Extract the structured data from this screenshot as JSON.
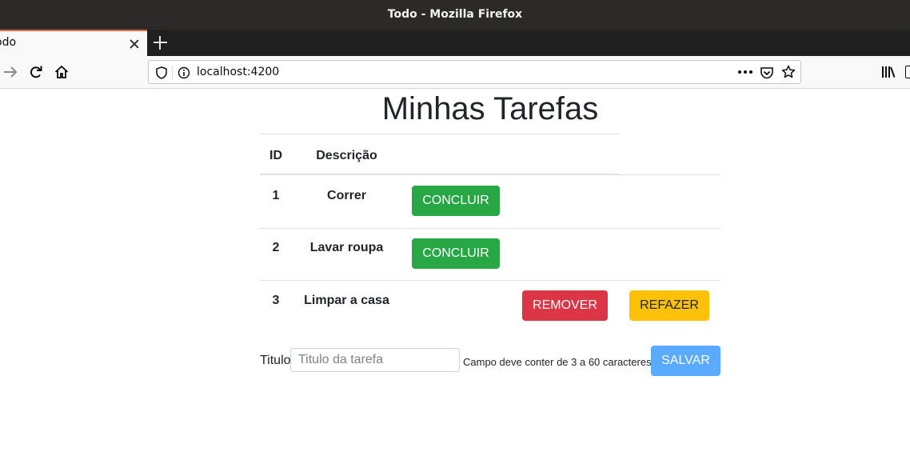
{
  "window": {
    "title": "Todo - Mozilla Firefox"
  },
  "tab": {
    "title": "odo"
  },
  "urlbar": {
    "url": "localhost:4200"
  },
  "icons": {
    "back": "arrow-right-icon",
    "reload": "reload-icon",
    "home": "home-icon",
    "shield": "shield-icon",
    "info": "info-icon",
    "more": "more-dots-icon",
    "pocket": "pocket-icon",
    "bookmark": "star-icon",
    "library": "library-icon"
  },
  "page": {
    "title": "Minhas Tarefas",
    "table": {
      "headers": [
        "ID",
        "Descrição"
      ],
      "rows": [
        {
          "id": "1",
          "description": "Correr",
          "action": "CONCLUIR"
        },
        {
          "id": "2",
          "description": "Lavar roupa",
          "action": "CONCLUIR"
        },
        {
          "id": "3",
          "description": "Limpar a casa",
          "remove": "REMOVER",
          "redo": "REFAZER"
        }
      ]
    },
    "form": {
      "label": "Titulo",
      "placeholder": "Titulo da tarefa",
      "value": "",
      "help": "Campo deve conter de 3 a 60 caracteres",
      "submit": "SALVAR"
    }
  },
  "colors": {
    "success": "#28a745",
    "danger": "#dc3545",
    "warning": "#ffc107",
    "primary_disabled": "#5aabff",
    "tab_accent": "#e8663d"
  }
}
